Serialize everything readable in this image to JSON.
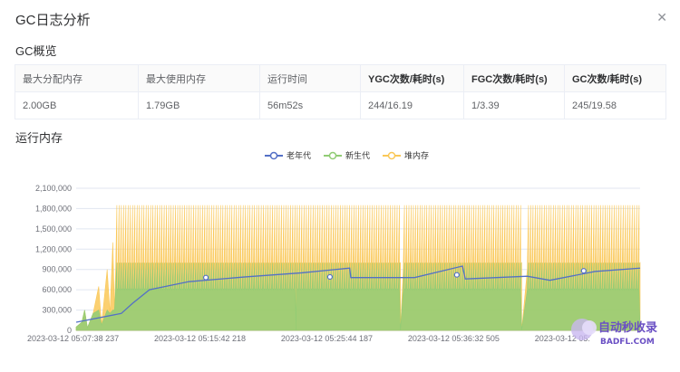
{
  "dialog": {
    "title": "GC日志分析",
    "close_icon": "close-icon"
  },
  "overview": {
    "heading": "GC概览",
    "headers": [
      "最大分配内存",
      "最大使用内存",
      "运行时间",
      "YGC次数/耗时(s)",
      "FGC次数/耗时(s)",
      "GC次数/耗时(s)"
    ],
    "values": [
      "2.00GB",
      "1.79GB",
      "56m52s",
      "244/16.19",
      "1/3.39",
      "245/19.58"
    ]
  },
  "runtime": {
    "heading": "运行内存"
  },
  "colors": {
    "old": "#5470c6",
    "young": "#91cc75",
    "heap": "#fac858"
  },
  "chart_data": {
    "type": "area",
    "legend": [
      "老年代",
      "新生代",
      "堆内存"
    ],
    "legend_position": "top-center",
    "ylim": [
      0,
      2100000
    ],
    "yticks": [
      "0",
      "300,000",
      "600,000",
      "900,000",
      "1,200,000",
      "1,500,000",
      "1,800,000",
      "2,100,000"
    ],
    "yticks_values": [
      0,
      300000,
      600000,
      900000,
      1200000,
      1500000,
      1800000,
      2100000
    ],
    "xticks": [
      "2023-03-12 05:07:38 237",
      "2023-03-12 05:15:42 218",
      "2023-03-12 05:25:44 187",
      "2023-03-12 05:36:32 505",
      "2023-03-12 05:"
    ],
    "grid": true,
    "series": [
      {
        "name": "老年代",
        "points": [
          [
            0,
            120000
          ],
          [
            0.08,
            250000
          ],
          [
            0.1,
            400000
          ],
          [
            0.13,
            600000
          ],
          [
            0.2,
            720000
          ],
          [
            0.3,
            790000
          ],
          [
            0.4,
            850000
          ],
          [
            0.46,
            900000
          ],
          [
            0.485,
            920000
          ],
          [
            0.487,
            780000
          ],
          [
            0.6,
            780000
          ],
          [
            0.685,
            950000
          ],
          [
            0.69,
            760000
          ],
          [
            0.8,
            800000
          ],
          [
            0.84,
            740000
          ],
          [
            0.92,
            870000
          ],
          [
            1,
            920000
          ]
        ]
      },
      {
        "name": "新生代",
        "range": [
          0,
          1040000
        ],
        "note": "sawtooth young-generation usage"
      },
      {
        "name": "堆内存",
        "range": [
          0,
          1850000
        ],
        "note": "sawtooth heap usage with max around 1,850,000"
      }
    ]
  },
  "watermark": {
    "text1": "自动秒收录",
    "text2": "BADFL.COM"
  }
}
